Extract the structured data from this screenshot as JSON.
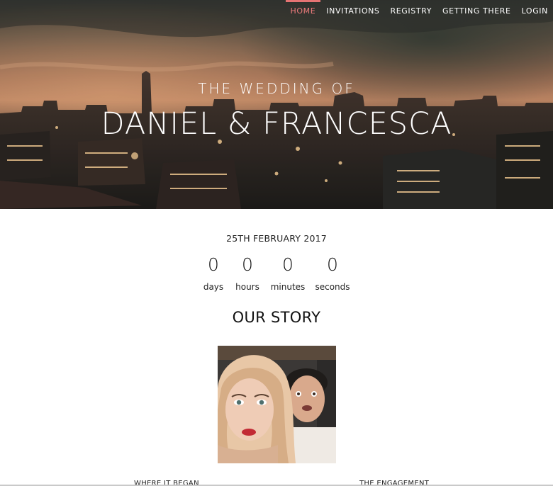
{
  "nav": {
    "items": [
      "HOME",
      "INVITATIONS",
      "REGISTRY",
      "GETTING THERE",
      "LOGIN"
    ],
    "active_index": 0,
    "accent_color": "#e57373"
  },
  "hero": {
    "subtitle": "THE WEDDING OF",
    "title": "DANIEL & FRANCESCA"
  },
  "event": {
    "date": "25TH FEBRUARY 2017"
  },
  "countdown": [
    {
      "value": "0",
      "label": "days"
    },
    {
      "value": "0",
      "label": "hours"
    },
    {
      "value": "0",
      "label": "minutes"
    },
    {
      "value": "0",
      "label": "seconds"
    }
  ],
  "story": {
    "heading": "OUR STORY",
    "columns": [
      "WHERE IT BEGAN",
      "THE ENGAGEMENT"
    ]
  }
}
